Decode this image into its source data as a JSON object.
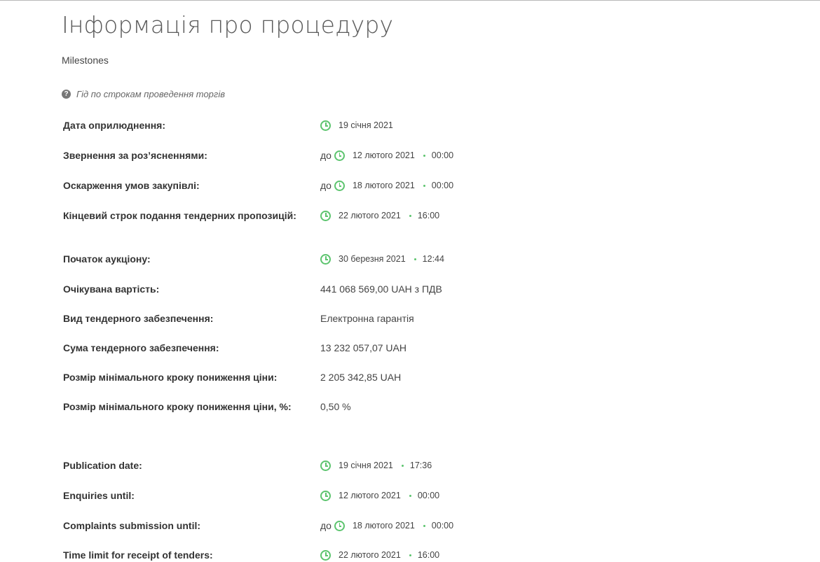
{
  "title": "Інформація про процедуру",
  "subtitle": "Milestones",
  "guide_link": "Гід по строкам проведення торгів",
  "rows_ua": [
    {
      "label": "Дата оприлюднення:",
      "prefix": "",
      "date": "19 січня 2021",
      "time": ""
    },
    {
      "label": "Звернення за роз’ясненнями:",
      "prefix": "до",
      "date": "12 лютого 2021",
      "time": "00:00"
    },
    {
      "label": "Оскарження умов закупівлі:",
      "prefix": "до",
      "date": "18 лютого 2021",
      "time": "00:00"
    },
    {
      "label": "Кінцевий строк подання тендерних пропозицій:",
      "prefix": "",
      "date": "22 лютого 2021",
      "time": "16:00"
    },
    {
      "label": "Початок аукціону:",
      "prefix": "",
      "date": "30 березня 2021",
      "time": "12:44"
    },
    {
      "label": "Очікувана вартість:",
      "value": "441 068 569,00 UAH з ПДВ"
    },
    {
      "label": "Вид тендерного забезпечення:",
      "value": "Електронна гарантія"
    },
    {
      "label": "Сума тендерного забезпечення:",
      "value": "13 232 057,07 UAH"
    },
    {
      "label": "Розмір мінімального кроку пониження ціни:",
      "value": "2 205 342,85 UAH"
    },
    {
      "label": "Розмір мінімального кроку пониження ціни, %:",
      "value": "0,50 %"
    }
  ],
  "rows_en": [
    {
      "label": "Publication date:",
      "prefix": "",
      "date": "19 січня 2021",
      "time": "17:36"
    },
    {
      "label": "Enquiries until:",
      "prefix": "",
      "date": "12 лютого 2021",
      "time": "00:00"
    },
    {
      "label": "Complaints submission until:",
      "prefix": "до",
      "date": "18 лютого 2021",
      "time": "00:00"
    },
    {
      "label": "Time limit for receipt of tenders:",
      "prefix": "",
      "date": "22 лютого 2021",
      "time": "16:00"
    }
  ],
  "colors": {
    "accent_green": "#5cc46e"
  },
  "icons": {
    "guide": "question-circle-icon",
    "date": "clock-icon"
  }
}
